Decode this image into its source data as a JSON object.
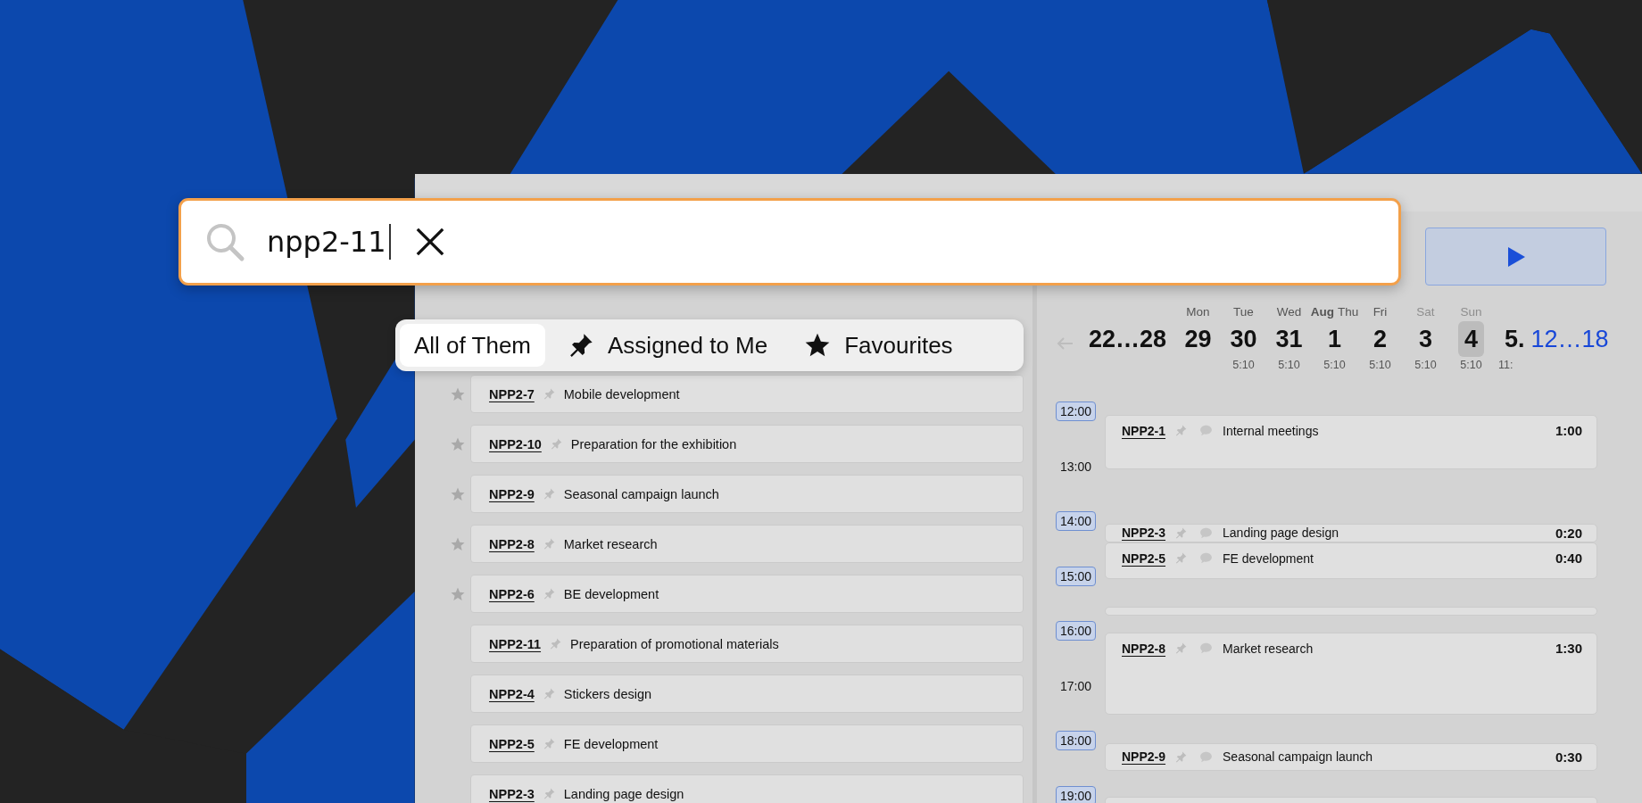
{
  "search": {
    "value": "npp2-11"
  },
  "filter_tabs": [
    {
      "label": "All of Them",
      "selected": true,
      "kind": "plain"
    },
    {
      "label": "Assigned to Me",
      "selected": false,
      "kind": "pin"
    },
    {
      "label": "Favourites",
      "selected": false,
      "kind": "star"
    }
  ],
  "date_strip": {
    "previous_disabled": true,
    "previous_range": "22…28",
    "days": [
      {
        "weekday": "Mon",
        "day": "29",
        "weekend": false,
        "selected": false
      },
      {
        "weekday": "Tue",
        "day": "30",
        "total": "5:10",
        "weekend": false,
        "selected": false
      },
      {
        "weekday": "Wed",
        "day": "31",
        "total": "5:10",
        "weekend": false,
        "selected": false
      },
      {
        "month": "Aug",
        "weekday": "Thu",
        "day": "1",
        "total": "5:10",
        "weekend": false,
        "selected": false
      },
      {
        "weekday": "Fri",
        "day": "2",
        "total": "5:10",
        "weekend": false,
        "selected": false
      },
      {
        "weekday": "Sat",
        "day": "3",
        "total": "5:10",
        "weekend": true,
        "selected": false
      },
      {
        "weekday": "Sun",
        "day": "4",
        "total": "5:10",
        "weekend": true,
        "selected": true
      },
      {
        "day": "5.",
        "total": "11:",
        "selected": false
      }
    ],
    "next_range": "12…18"
  },
  "tasks": [
    {
      "id": "NPP2-7",
      "title": "Mobile development",
      "starred": true
    },
    {
      "id": "NPP2-10",
      "title": "Preparation for the exhibition",
      "starred": true
    },
    {
      "id": "NPP2-9",
      "title": "Seasonal campaign launch",
      "starred": true
    },
    {
      "id": "NPP2-8",
      "title": "Market research",
      "starred": true
    },
    {
      "id": "NPP2-6",
      "title": "BE development",
      "starred": true
    },
    {
      "id": "NPP2-11",
      "title": "Preparation of promotional materials",
      "starred": false
    },
    {
      "id": "NPP2-4",
      "title": "Stickers design",
      "starred": false
    },
    {
      "id": "NPP2-5",
      "title": "FE development",
      "starred": false
    },
    {
      "id": "NPP2-3",
      "title": "Landing page design",
      "starred": false
    }
  ],
  "timeline": {
    "hours": [
      {
        "label": "12:00",
        "highlighted": true
      },
      {
        "label": "13:00",
        "highlighted": false
      },
      {
        "label": "14:00",
        "highlighted": true
      },
      {
        "label": "15:00",
        "highlighted": true
      },
      {
        "label": "16:00",
        "highlighted": true
      },
      {
        "label": "17:00",
        "highlighted": false
      },
      {
        "label": "18:00",
        "highlighted": true
      },
      {
        "label": "19:00",
        "highlighted": true
      }
    ],
    "events": [
      {
        "id": "NPP2-1",
        "title": "Internal meetings",
        "duration": "1:00"
      },
      {
        "id": "NPP2-3",
        "title": "Landing page design",
        "duration": "0:20"
      },
      {
        "id": "NPP2-5",
        "title": "FE development",
        "duration": "0:40"
      },
      {
        "id": "NPP2-8",
        "title": "Market research",
        "duration": "1:30"
      },
      {
        "id": "NPP2-9",
        "title": "Seasonal campaign launch",
        "duration": "0:30"
      }
    ]
  }
}
